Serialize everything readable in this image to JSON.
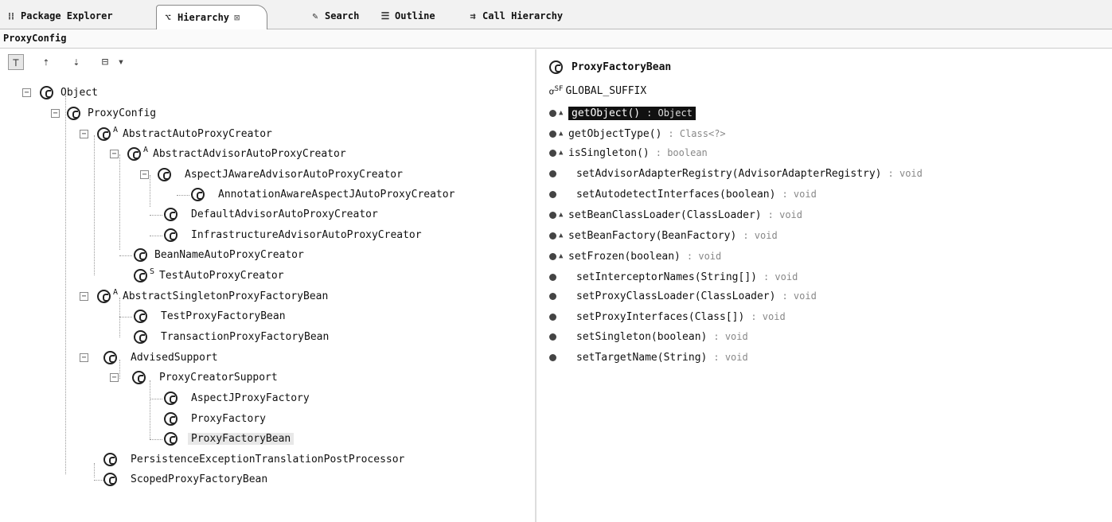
{
  "tabs": [
    {
      "label": "Package Explorer",
      "icon": "package-icon"
    },
    {
      "label": "Hierarchy",
      "icon": "hierarchy-icon",
      "close": "⊠"
    },
    {
      "label": "Search",
      "icon": "search-icon"
    },
    {
      "label": "Outline",
      "icon": "outline-icon"
    },
    {
      "label": "Call Hierarchy",
      "icon": "call-hierarchy-icon"
    }
  ],
  "title": "ProxyConfig",
  "toolbar": {
    "buttons": [
      "type-hierarchy-icon",
      "supertype-hierarchy-icon",
      "subtype-hierarchy-icon",
      "history-icon"
    ],
    "dropdown": "▾"
  },
  "tree": [
    {
      "label": "Object",
      "modifier": ""
    },
    {
      "label": "ProxyConfig",
      "modifier": ""
    },
    {
      "label": "AbstractAutoProxyCreator",
      "modifier": "A"
    },
    {
      "label": "AbstractAdvisorAutoProxyCreator",
      "modifier": "A"
    },
    {
      "label": "AspectJAwareAdvisorAutoProxyCreator",
      "modifier": ""
    },
    {
      "label": "AnnotationAwareAspectJAutoProxyCreator",
      "modifier": ""
    },
    {
      "label": "DefaultAdvisorAutoProxyCreator",
      "modifier": ""
    },
    {
      "label": "InfrastructureAdvisorAutoProxyCreator",
      "modifier": ""
    },
    {
      "label": "BeanNameAutoProxyCreator",
      "modifier": ""
    },
    {
      "label": "TestAutoProxyCreator",
      "modifier": "S"
    },
    {
      "label": "AbstractSingletonProxyFactoryBean",
      "modifier": "A"
    },
    {
      "label": "TestProxyFactoryBean",
      "modifier": ""
    },
    {
      "label": "TransactionProxyFactoryBean",
      "modifier": ""
    },
    {
      "label": "AdvisedSupport",
      "modifier": ""
    },
    {
      "label": "ProxyCreatorSupport",
      "modifier": ""
    },
    {
      "label": "AspectJProxyFactory",
      "modifier": ""
    },
    {
      "label": "ProxyFactory",
      "modifier": ""
    },
    {
      "label": "ProxyFactoryBean",
      "modifier": ""
    },
    {
      "label": "PersistenceExceptionTranslationPostProcessor",
      "modifier": ""
    },
    {
      "label": "ScopedProxyFactoryBean",
      "modifier": ""
    }
  ],
  "members_panel": {
    "class_name": "ProxyFactoryBean",
    "field": {
      "name": "GLOBAL_SUFFIX",
      "modifier": "SF"
    },
    "members": [
      {
        "name": "getObject()",
        "type": ": Object",
        "protected": true
      },
      {
        "name": "getObjectType()",
        "type": ": Class<?>",
        "protected": true
      },
      {
        "name": "isSingleton()",
        "type": ": boolean",
        "protected": true
      },
      {
        "name": "setAdvisorAdapterRegistry(AdvisorAdapterRegistry)",
        "type": ": void",
        "protected": false
      },
      {
        "name": "setAutodetectInterfaces(boolean)",
        "type": ": void",
        "protected": false
      },
      {
        "name": "setBeanClassLoader(ClassLoader)",
        "type": ": void",
        "protected": true
      },
      {
        "name": "setBeanFactory(BeanFactory)",
        "type": ": void",
        "protected": true
      },
      {
        "name": "setFrozen(boolean)",
        "type": ": void",
        "protected": true
      },
      {
        "name": "setInterceptorNames(String[])",
        "type": ": void",
        "protected": false
      },
      {
        "name": "setProxyClassLoader(ClassLoader)",
        "type": ": void",
        "protected": false
      },
      {
        "name": "setProxyInterfaces(Class[])",
        "type": ": void",
        "protected": false
      },
      {
        "name": "setSingleton(boolean)",
        "type": ": void",
        "protected": false
      },
      {
        "name": "setTargetName(String)",
        "type": ": void",
        "protected": false
      }
    ]
  }
}
